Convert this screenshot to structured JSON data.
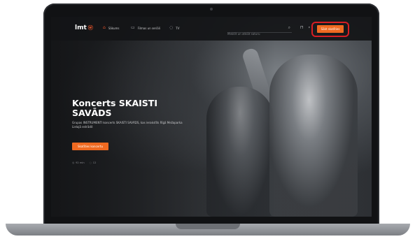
{
  "nav": {
    "logo_text": "lmt",
    "logo_mark": "ⓦ",
    "items": [
      {
        "label": "Sākums",
        "icon": "home-icon",
        "glyph": "⌂"
      },
      {
        "label": "Filmas un seriāli",
        "icon": "film-icon",
        "glyph": "▭"
      },
      {
        "label": "TV",
        "icon": "tv-icon",
        "glyph": "◌"
      }
    ],
    "search_placeholder": "Meklēt un atklāt saturu",
    "cta_label": "Sākt skatīties"
  },
  "hero": {
    "title": "Koncerts SKAISTI SAVĀDS",
    "description": "Grupas INSTRUMENTI koncerts SKAISTI SAVĀDS, kas ierakstīts Rīgā Mežaparka Lielajā estrādē",
    "button_label": "Skatīties koncertu",
    "meta": [
      {
        "icon": "clock-icon",
        "glyph": "◷",
        "text": "92 min"
      },
      {
        "icon": "age-icon",
        "glyph": "◌",
        "text": "12"
      }
    ]
  },
  "colors": {
    "accent": "#ef6a21",
    "highlight": "#d81e24",
    "background": "#1f2124"
  }
}
